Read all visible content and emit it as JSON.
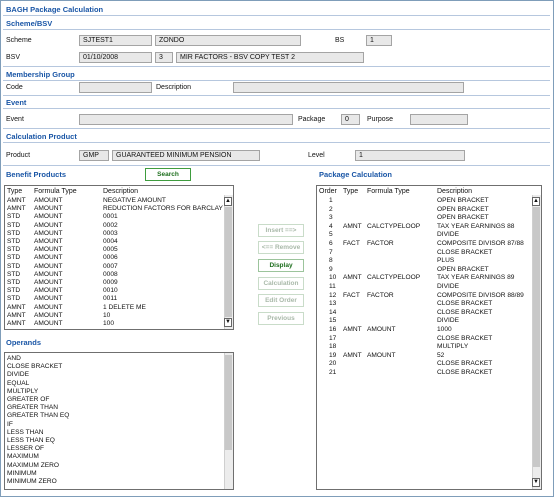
{
  "title": "BAGH Package Calculation",
  "scheme_section": {
    "heading": "Scheme/BSV",
    "scheme_label": "Scheme",
    "scheme_code": "SJTEST1",
    "scheme_name": "ZONDO",
    "bs_label": "BS",
    "bs_value": "1",
    "bsv_label": "BSV",
    "bsv_date": "01/10/2008",
    "bsv_num": "3",
    "bsv_desc": "MIR FACTORS - BSV COPY TEST 2"
  },
  "membership_section": {
    "heading": "Membership Group",
    "code_label": "Code",
    "code_value": "",
    "description_label": "Description",
    "description_value": ""
  },
  "event_section": {
    "heading": "Event",
    "event_label": "Event",
    "event_value": "",
    "package_label": "Package",
    "package_value": "0",
    "purpose_label": "Purpose",
    "purpose_value": ""
  },
  "calc_product_section": {
    "heading": "Calculation Product",
    "product_label": "Product",
    "product_code": "GMP",
    "product_name": "GUARANTEED MINIMUM PENSION",
    "level_label": "Level",
    "level_value": "1"
  },
  "benefit_products": {
    "heading": "Benefit Products",
    "search_label": "Search",
    "columns": [
      "Type",
      "Formula Type",
      "Description"
    ],
    "rows": [
      [
        "AMNT",
        "AMOUNT",
        "NEGATIVE AMOUNT"
      ],
      [
        "AMNT",
        "AMOUNT",
        "REDUCTION FACTORS FOR BARCLAY"
      ],
      [
        "STD",
        "AMOUNT",
        "0001"
      ],
      [
        "STD",
        "AMOUNT",
        "0002"
      ],
      [
        "STD",
        "AMOUNT",
        "0003"
      ],
      [
        "STD",
        "AMOUNT",
        "0004"
      ],
      [
        "STD",
        "AMOUNT",
        "0005"
      ],
      [
        "STD",
        "AMOUNT",
        "0006"
      ],
      [
        "STD",
        "AMOUNT",
        "0007"
      ],
      [
        "STD",
        "AMOUNT",
        "0008"
      ],
      [
        "STD",
        "AMOUNT",
        "0009"
      ],
      [
        "STD",
        "AMOUNT",
        "0010"
      ],
      [
        "STD",
        "AMOUNT",
        "0011"
      ],
      [
        "AMNT",
        "AMOUNT",
        "1 DELETE ME"
      ],
      [
        "AMNT",
        "AMOUNT",
        "10"
      ],
      [
        "AMNT",
        "AMOUNT",
        "100"
      ]
    ]
  },
  "buttons": {
    "insert": "Insert ==>",
    "remove": "<== Remove",
    "display": "Display",
    "calculation": "Calculation",
    "edit_order": "Edit Order",
    "previous": "Previous"
  },
  "operands": {
    "heading": "Operands",
    "items": [
      "AND",
      "CLOSE BRACKET",
      "DIVIDE",
      "EQUAL",
      "MULTIPLY",
      "GREATER OF",
      "GREATER THAN",
      "GREATER THAN EQ",
      "IF",
      "LESS THAN",
      "LESS THAN EQ",
      "LESSER OF",
      "MAXIMUM",
      "MAXIMUM ZERO",
      "MINIMUM",
      "MINIMUM ZERO"
    ]
  },
  "package_calculation": {
    "heading": "Package Calculation",
    "columns": [
      "Order",
      "Type",
      "Formula Type",
      "Description"
    ],
    "rows": [
      [
        "1",
        "",
        "",
        "OPEN BRACKET"
      ],
      [
        "2",
        "",
        "",
        "OPEN BRACKET"
      ],
      [
        "3",
        "",
        "",
        "OPEN BRACKET"
      ],
      [
        "4",
        "AMNT",
        "CALCTYPELOOP",
        "TAX YEAR EARNINGS 88"
      ],
      [
        "5",
        "",
        "",
        "DIVIDE"
      ],
      [
        "6",
        "FACT",
        "FACTOR",
        "COMPOSITE DIVISOR 87/88"
      ],
      [
        "7",
        "",
        "",
        "CLOSE BRACKET"
      ],
      [
        "8",
        "",
        "",
        "PLUS"
      ],
      [
        "9",
        "",
        "",
        "OPEN BRACKET"
      ],
      [
        "10",
        "AMNT",
        "CALCTYPELOOP",
        "TAX YEAR EARNINGS 89"
      ],
      [
        "11",
        "",
        "",
        "DIVIDE"
      ],
      [
        "12",
        "FACT",
        "FACTOR",
        "COMPOSITE DIVISOR 88/89"
      ],
      [
        "13",
        "",
        "",
        "CLOSE BRACKET"
      ],
      [
        "14",
        "",
        "",
        "CLOSE BRACKET"
      ],
      [
        "15",
        "",
        "",
        "DIVIDE"
      ],
      [
        "16",
        "AMNT",
        "AMOUNT",
        "1000"
      ],
      [
        "17",
        "",
        "",
        "CLOSE BRACKET"
      ],
      [
        "18",
        "",
        "",
        "MULTIPLY"
      ],
      [
        "19",
        "AMNT",
        "AMOUNT",
        "52"
      ],
      [
        "20",
        "",
        "",
        "CLOSE BRACKET"
      ],
      [
        "21",
        "",
        "",
        "CLOSE BRACKET"
      ]
    ]
  },
  "icons": {
    "scroll_up": "scroll-up-arrow-icon",
    "scroll_down": "scroll-down-arrow-icon"
  }
}
